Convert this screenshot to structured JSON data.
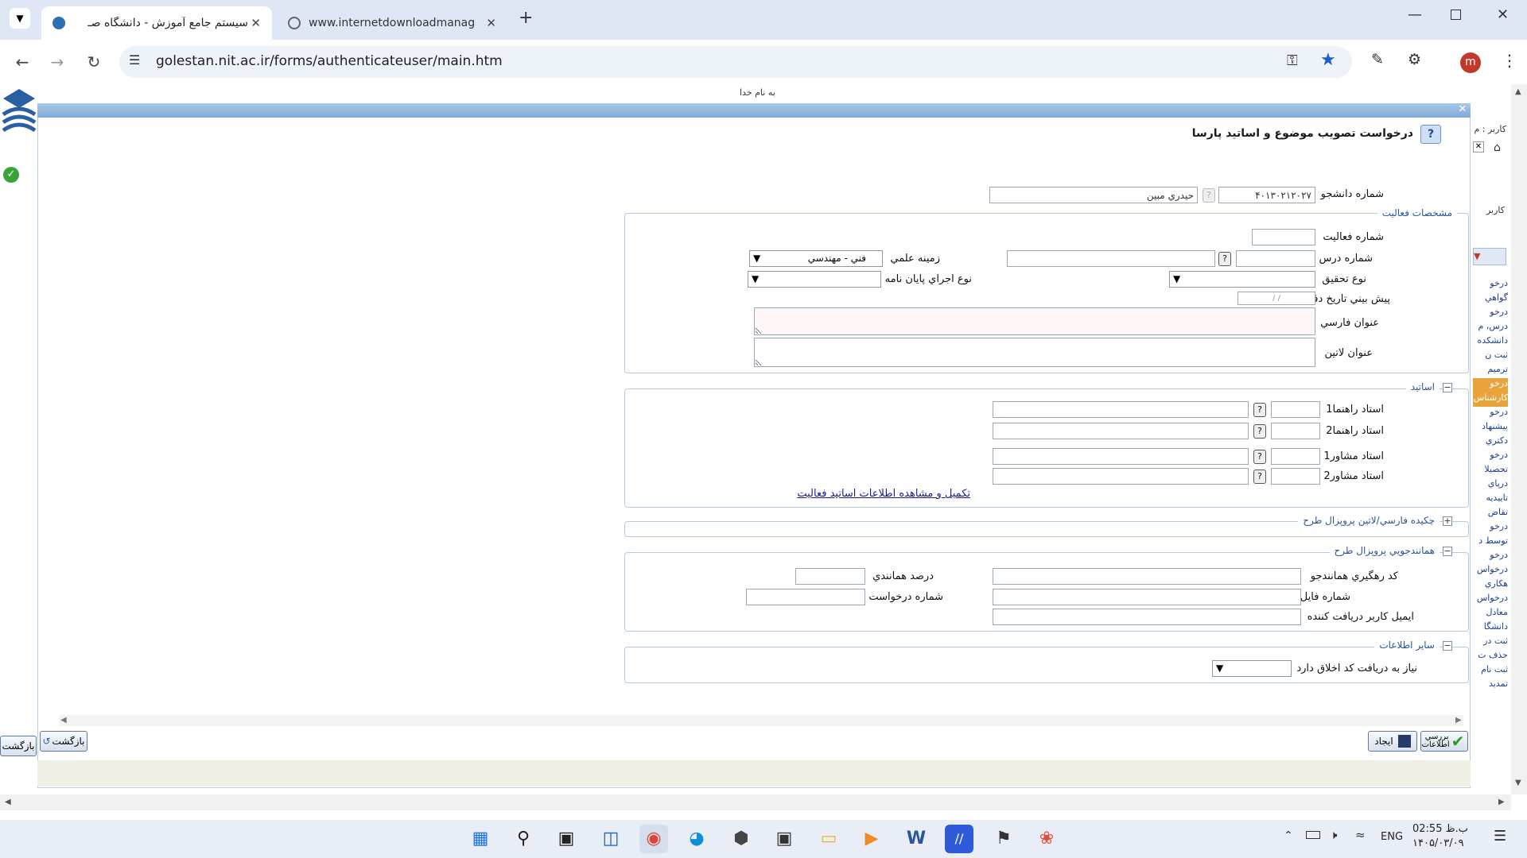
{
  "tabs": [
    {
      "title": "سیستم جامع آموزش - دانشگاه صـ",
      "active": true
    },
    {
      "title": "www.internetdownloadmanage",
      "active": false
    }
  ],
  "toolbar": {
    "url": "golestan.nit.ac.ir/forms/authenticateuser/main.htm",
    "profile_initial": "m"
  },
  "page": {
    "banner": "به نام خدا"
  },
  "form": {
    "title": "درخواست تصويب موضوع و اساتيد پارسا",
    "student": {
      "label": "شماره دانشجو",
      "id": "۴۰۱۳۰۲۱۲۰۲۷",
      "name": "حيدري مبين"
    },
    "activity": {
      "legend": "مشخصات فعاليت",
      "activity_no_label": "شماره فعاليت",
      "course_no_label": "شماره درس",
      "field_label": "زمينه علمي",
      "field_value": "فني - مهندسي",
      "research_type_label": "نوع تحقيق",
      "thesis_type_label": "نوع اجراي پايان نامه",
      "defense_date_label": "پيش بيني تاريخ دفاع",
      "defense_date_placeholder": "/ /",
      "title_fa_label": "عنوان فارسي",
      "title_en_label": "عنوان لاتين"
    },
    "professors": {
      "legend": "اساتيد",
      "sup1": "استاد راهنما1",
      "sup2": "استاد راهنما2",
      "adv1": "استاد مشاور1",
      "adv2": "استاد مشاور2",
      "link": "تكميل و مشاهده اطلاعات اساتيد فعاليت"
    },
    "abstract": {
      "legend": "چكيده فارسي/لاتين پروپزال طرح"
    },
    "similarity": {
      "legend": "همانندجويي پروپزال طرح",
      "tracking_label": "كد رهگيري همانندجو",
      "percent_label": "درصد همانندي",
      "file_label": "شماره فايل",
      "request_label": "شماره درخواست",
      "email_label": "ايميل كاربر دريافت كننده"
    },
    "other": {
      "legend": "ساير اطلاعات",
      "ethics_label": "نياز به دريافت كد اخلاق دارد"
    }
  },
  "buttons": {
    "back": "بازگشت",
    "create": "ايجاد",
    "review": "بررسي اطلاعات",
    "back_outer": "بازگشت"
  },
  "right_panel": {
    "user_label": "كاربر : م",
    "user2": "كاربر",
    "items": [
      "درخو",
      "گواهي",
      "درخو",
      "درس، م",
      "دانشكده",
      "ثبت ن",
      "ترميم",
      "درخو",
      "كارشناس",
      "درخو",
      "پيشنهاد",
      "دكتري",
      "درخو",
      "تحصيلا",
      "درپاي",
      "تاييديه",
      "تقاض",
      "درخو",
      "توسط د",
      "درخو",
      "درخواس",
      "هكاري",
      "درخواس",
      "معادل",
      "دانشگا",
      "ثبت در",
      "حذف ت",
      "ثبت نام",
      "تمديد"
    ]
  },
  "taskbar": {
    "lang": "ENG",
    "time": "02:55 ب.ظ",
    "date": "۱۴۰۵/۰۳/۰۹"
  }
}
